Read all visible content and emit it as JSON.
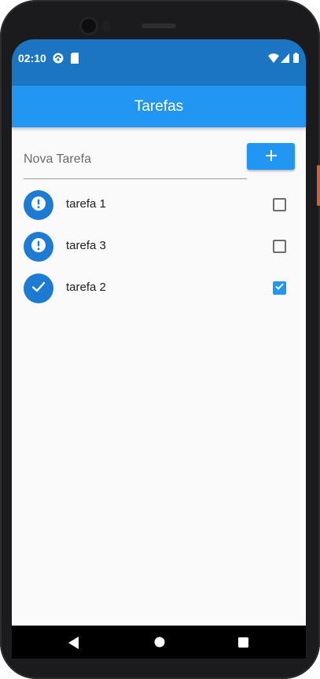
{
  "status_bar": {
    "time": "02:10",
    "left_icons": [
      "app-notification-icon",
      "sd-card-icon"
    ],
    "right_icons": [
      "wifi-icon",
      "cell-signal-icon",
      "battery-icon"
    ],
    "color": "#1b75c2"
  },
  "app_bar": {
    "title": "Tarefas",
    "color": "#2196f3"
  },
  "new_task": {
    "placeholder": "Nova Tarefa",
    "value": "",
    "add_icon": "plus-icon"
  },
  "tasks": [
    {
      "label": "tarefa 1",
      "done": false,
      "icon": "alert-icon"
    },
    {
      "label": "tarefa 3",
      "done": false,
      "icon": "alert-icon"
    },
    {
      "label": "tarefa 2",
      "done": true,
      "icon": "check-icon"
    }
  ],
  "nav_bar": {
    "buttons": [
      "back-icon",
      "home-icon",
      "recents-icon"
    ]
  }
}
